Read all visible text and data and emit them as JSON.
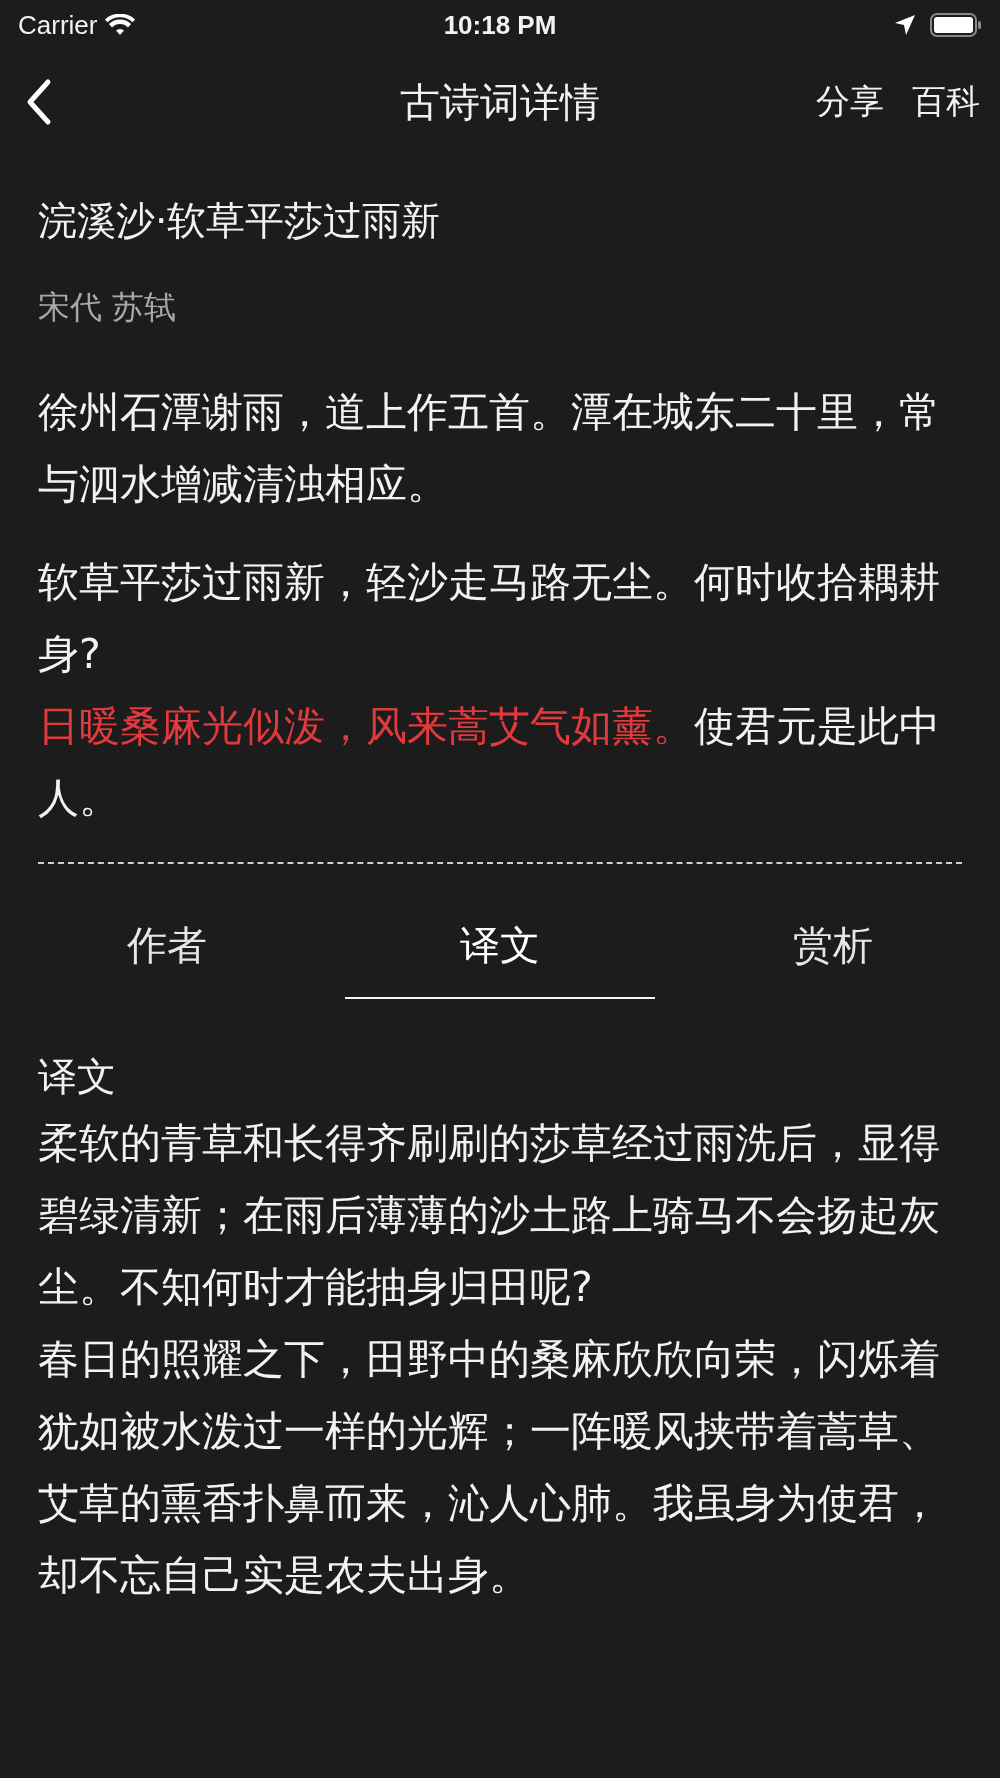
{
  "status_bar": {
    "carrier": "Carrier",
    "time": "10:18 PM"
  },
  "nav": {
    "title": "古诗词详情",
    "actions": [
      "分享",
      "百科"
    ]
  },
  "poem": {
    "title": "浣溪沙·软草平莎过雨新",
    "author": "宋代 苏轼",
    "preface": "徐州石潭谢雨，道上作五首。潭在城东二十里，常与泗水增减清浊相应。",
    "lines": [
      [
        {
          "text": "软草平莎过雨新，轻沙走马路无尘。何时收拾耦耕身?",
          "highlighted": false
        }
      ],
      [
        {
          "text": "日暖桑麻光似泼，风来蒿艾气如薰。",
          "highlighted": true
        },
        {
          "text": "使君元是此中人。",
          "highlighted": false
        }
      ]
    ]
  },
  "tabs": [
    {
      "label": "作者",
      "selected": false
    },
    {
      "label": "译文",
      "selected": true
    },
    {
      "label": "赏析",
      "selected": false
    }
  ],
  "section": {
    "heading": "译文",
    "paragraphs": [
      "柔软的青草和长得齐刷刷的莎草经过雨洗后，显得碧绿清新；在雨后薄薄的沙土路上骑马不会扬起灰尘。不知何时才能抽身归田呢?",
      "春日的照耀之下，田野中的桑麻欣欣向荣，闪烁着犹如被水泼过一样的光辉；一阵暖风挟带着蒿草、艾草的熏香扑鼻而来，沁人心肺。我虽身为使君，却不忘自己实是农夫出身。"
    ]
  }
}
